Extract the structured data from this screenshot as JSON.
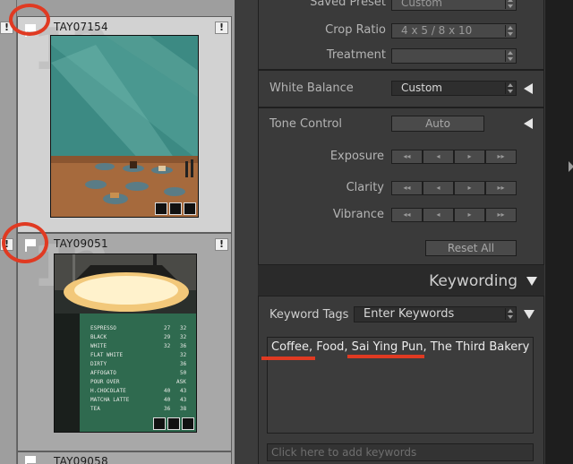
{
  "grid": {
    "cells": [
      {
        "index": "12",
        "filename": "TAY07154",
        "flag_badge": "!",
        "left_badge": "!"
      },
      {
        "index": "12",
        "filename": "TAY09051",
        "flag_badge": "!",
        "left_badge": "!"
      },
      {
        "filename": "TAY09058"
      }
    ]
  },
  "panel": {
    "saved_preset": {
      "label": "Saved Preset",
      "value": "Custom"
    },
    "crop_ratio": {
      "label": "Crop Ratio",
      "value": "4 x 5  /  8 x 10"
    },
    "treatment": {
      "label": "Treatment",
      "value": ""
    },
    "white_balance": {
      "label": "White Balance",
      "value": "Custom"
    },
    "tone_control": {
      "label": "Tone Control",
      "button": "Auto"
    },
    "sliders": [
      {
        "label": "Exposure"
      },
      {
        "label": "Clarity"
      },
      {
        "label": "Vibrance"
      }
    ],
    "stepper_glyphs": [
      "◂◂",
      "◂",
      "▸",
      "▸▸"
    ],
    "reset_all": "Reset All"
  },
  "keywording": {
    "title": "Keywording",
    "tags_label": "Keyword Tags",
    "tags_dropdown": "Enter Keywords",
    "keywords_text": "Coffee, Food, Sai Ying Pun, The Third Bakery",
    "add_placeholder": "Click here to add keywords"
  },
  "colors": {
    "annotation_red": "#e03a22",
    "panel_bg": "#2a2a2a",
    "section_bg": "#3a3a3a"
  }
}
